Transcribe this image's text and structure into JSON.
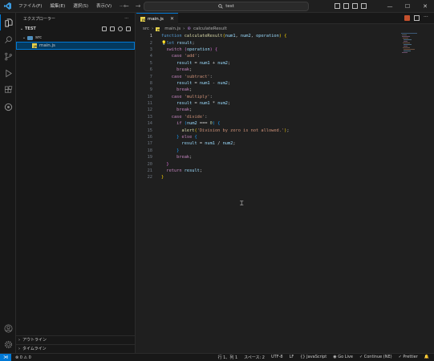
{
  "titlebar": {
    "menus": [
      "ファイル(F)",
      "編集(E)",
      "選択(S)",
      "表示(V)",
      "···"
    ],
    "search": "test",
    "nav_back": "←",
    "nav_forward": "→",
    "win_minimize": "—",
    "win_maximize": "☐",
    "win_close": "✕"
  },
  "sidebar": {
    "title": "エクスプローラー",
    "more": "···",
    "root": "TEST",
    "folder": "src",
    "file": "main.js",
    "outline": "アウトライン",
    "timeline": "タイムライン"
  },
  "editor": {
    "tab_label": "main.js",
    "tab_close": "✕",
    "breadcrumb": [
      "src",
      "main.js",
      "calculateResult"
    ],
    "breadcrumb_sep": "›",
    "line_numbers": [
      "1",
      "2",
      "3",
      "4",
      "5",
      "6",
      "7",
      "8",
      "9",
      "10",
      "11",
      "12",
      "13",
      "14",
      "15",
      "16",
      "17",
      "18",
      "19",
      "20",
      "21",
      "22"
    ]
  },
  "statusbar": {
    "problems": "⊗ 0 ⚠ 0",
    "position": "行 1、列 1",
    "spaces": "スペース: 2",
    "encoding": "UTF-8",
    "eol": "LF",
    "language": "{} JavaScript",
    "golive": "Go Live",
    "continue": "Continue (NE)",
    "prettier": "✓ Prettier"
  },
  "colors": {
    "accent": "#0078d4",
    "keyword": "#569cd6",
    "control": "#c586c0",
    "function": "#dcdcaa",
    "variable": "#9cdcfe",
    "string": "#ce9178",
    "number": "#b5cea8"
  }
}
